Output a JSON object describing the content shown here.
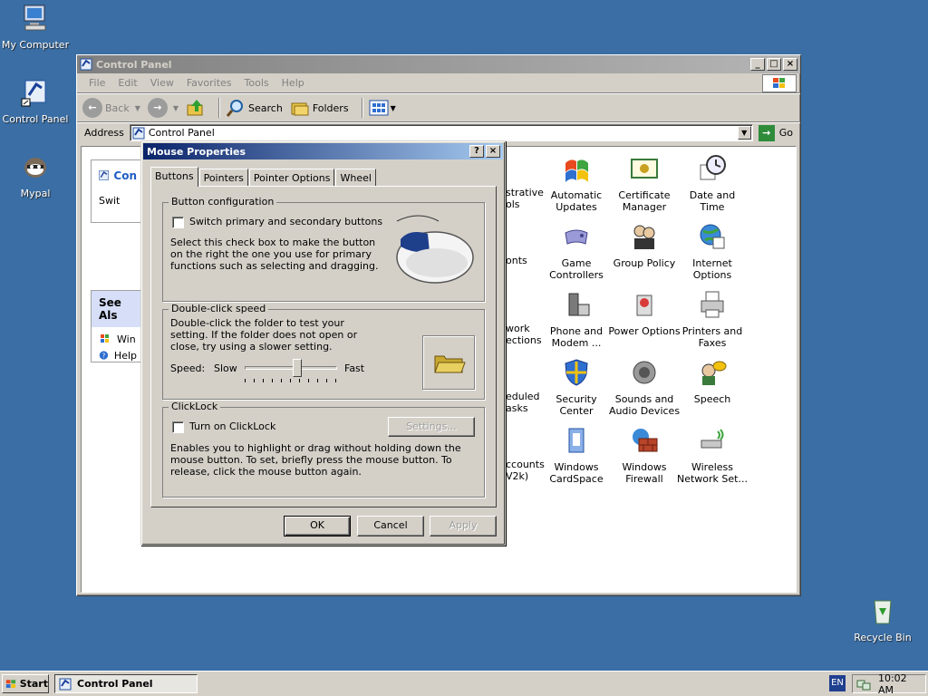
{
  "desktop": {
    "icons": [
      {
        "label": "My Computer",
        "icon": "computer-icon"
      },
      {
        "label": "Control Panel",
        "icon": "control-panel-icon"
      },
      {
        "label": "Mypal",
        "icon": "mypal-icon"
      },
      {
        "label": "Recycle Bin",
        "icon": "recycle-bin-icon"
      }
    ]
  },
  "cp_window": {
    "title": "Control Panel",
    "menu": [
      "File",
      "Edit",
      "View",
      "Favorites",
      "Tools",
      "Help"
    ],
    "toolbar": {
      "back": "Back",
      "search": "Search",
      "folders": "Folders"
    },
    "address_label": "Address",
    "address_value": "Control Panel",
    "go_label": "Go",
    "sidebar": {
      "panel_title_fragment": "Con",
      "switch_fragment": "Swit",
      "see_also": "See Als",
      "links": [
        "Win",
        "Help"
      ]
    },
    "partial_labels": [
      "strative",
      "ols",
      "onts",
      "work",
      "ections",
      "eduled",
      "asks",
      "ccounts",
      "V2k)"
    ],
    "icons": [
      {
        "label": "Automatic Updates",
        "icon": "automatic-updates-icon"
      },
      {
        "label": "Certificate Manager",
        "icon": "certificate-icon"
      },
      {
        "label": "Date and Time",
        "icon": "clock-icon"
      },
      {
        "label": "Game Controllers",
        "icon": "gamepad-icon"
      },
      {
        "label": "Group Policy",
        "icon": "group-policy-icon"
      },
      {
        "label": "Internet Options",
        "icon": "globe-icon"
      },
      {
        "label": "Phone and Modem ...",
        "icon": "phone-icon"
      },
      {
        "label": "Power Options",
        "icon": "power-icon"
      },
      {
        "label": "Printers and Faxes",
        "icon": "printer-icon"
      },
      {
        "label": "Security Center",
        "icon": "shield-icon"
      },
      {
        "label": "Sounds and Audio Devices",
        "icon": "speaker-icon"
      },
      {
        "label": "Speech",
        "icon": "speech-icon"
      },
      {
        "label": "Windows CardSpace",
        "icon": "cardspace-icon"
      },
      {
        "label": "Windows Firewall",
        "icon": "firewall-icon"
      },
      {
        "label": "Wireless Network Set...",
        "icon": "wireless-icon"
      }
    ]
  },
  "dialog": {
    "title": "Mouse Properties",
    "tabs": [
      "Buttons",
      "Pointers",
      "Pointer Options",
      "Wheel"
    ],
    "button_config": {
      "title": "Button configuration",
      "checkbox_label": "Switch primary and secondary buttons",
      "description": "Select this check box to make the button on the right the one you use for primary functions such as selecting and dragging."
    },
    "double_click": {
      "title": "Double-click speed",
      "description": "Double-click the folder to test your setting. If the folder does not open or close, try using a slower setting.",
      "speed_label": "Speed:",
      "slow": "Slow",
      "fast": "Fast",
      "slider_value": 0.58
    },
    "clicklock": {
      "title": "ClickLock",
      "checkbox_label": "Turn on ClickLock",
      "settings_button": "Settings...",
      "description": "Enables you to highlight or drag without holding down the mouse button. To set, briefly press the mouse button. To release, click the mouse button again."
    },
    "buttons": {
      "ok": "OK",
      "cancel": "Cancel",
      "apply": "Apply"
    }
  },
  "taskbar": {
    "start": "Start",
    "task": "Control Panel",
    "lang": "EN",
    "clock": "10:02 AM"
  }
}
